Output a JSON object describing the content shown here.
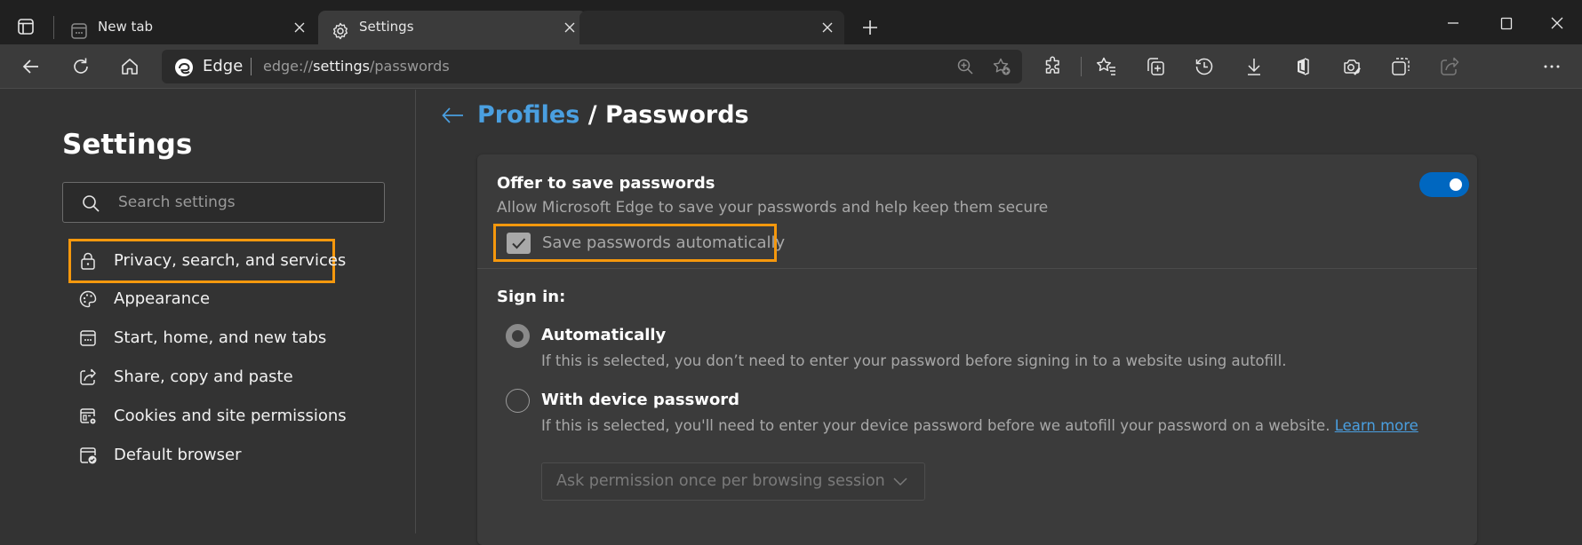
{
  "browser": {
    "tabs": [
      {
        "title": "New tab",
        "icon": "new-tab-page-icon",
        "state": "inactive"
      },
      {
        "title": "Settings",
        "icon": "gear-icon",
        "state": "active"
      },
      {
        "title": "",
        "icon": "",
        "state": "inactive"
      }
    ],
    "address_bar": {
      "site_label": "Edge",
      "url_prefix": "edge://",
      "url_host": "settings",
      "url_path": "/passwords"
    },
    "toolbar_icons": [
      "back-icon",
      "refresh-icon",
      "home-icon",
      "zoom-icon",
      "add-favorite-icon",
      "extensions-icon",
      "favorites-icon",
      "collections-icon",
      "history-icon",
      "downloads-icon",
      "office-icon",
      "web-capture-icon",
      "screenshot-icon",
      "share-icon",
      "more-icon"
    ],
    "window_controls": [
      "minimize",
      "maximize",
      "close"
    ]
  },
  "sidebar": {
    "title": "Settings",
    "search_placeholder": "Search settings",
    "search_value": "",
    "items": [
      {
        "label": "Privacy, search, and services",
        "icon": "lock-icon",
        "highlighted": true
      },
      {
        "label": "Appearance",
        "icon": "palette-icon"
      },
      {
        "label": "Start, home, and new tabs",
        "icon": "start-page-icon"
      },
      {
        "label": "Share, copy and paste",
        "icon": "share-icon"
      },
      {
        "label": "Cookies and site permissions",
        "icon": "cookies-permissions-icon"
      },
      {
        "label": "Default browser",
        "icon": "default-browser-icon"
      }
    ]
  },
  "main": {
    "breadcrumb": {
      "parent": "Profiles",
      "separator": "/",
      "current": "Passwords"
    },
    "offer_to_save": {
      "title": "Offer to save passwords",
      "description": "Allow Microsoft Edge to save your passwords and help keep them secure",
      "toggle_on": true,
      "auto_save_label": "Save passwords automatically",
      "auto_save_checked": true,
      "auto_save_disabled": true
    },
    "sign_in": {
      "title": "Sign in:",
      "selected": "automatically",
      "options": [
        {
          "id": "automatically",
          "label": "Automatically",
          "description": "If this is selected, you don’t need to enter your password before signing in to a website using autofill."
        },
        {
          "id": "device_password",
          "label": "With device password",
          "description": "If this is selected, you'll need to enter your device password before we autofill your password on a website.",
          "link": "Learn more"
        }
      ],
      "frequency_select": {
        "value": "Ask permission once per browsing session",
        "disabled": true
      }
    }
  },
  "colors": {
    "accent": "#0067c0",
    "link": "#4a9fe0",
    "highlight_outline": "#f5980d"
  }
}
